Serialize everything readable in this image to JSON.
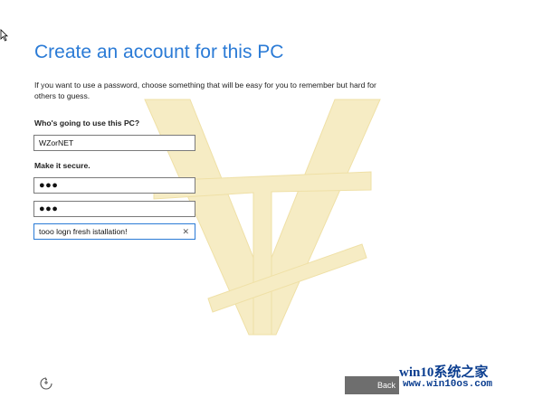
{
  "page": {
    "title": "Create an account for this PC",
    "description": "If you want to use a password, choose something that will be easy for you to remember but hard for others to guess."
  },
  "form": {
    "user_label": "Who's going to use this PC?",
    "username_value": "WZorNET",
    "secure_label": "Make it secure.",
    "password_mask": "●●●",
    "confirm_mask": "●●●",
    "hint_value": "tooo logn fresh istallation!",
    "clear_glyph": "✕"
  },
  "footer": {
    "back_label": "Back",
    "ease_icon": "ease-of-access-icon"
  },
  "watermark": {
    "brand": "win10系统之家",
    "url": "www.win10os.com"
  },
  "colors": {
    "accent": "#2b7bd6",
    "watermark_monogram": "#f6ecc4",
    "brand": "#0a3d8f"
  }
}
